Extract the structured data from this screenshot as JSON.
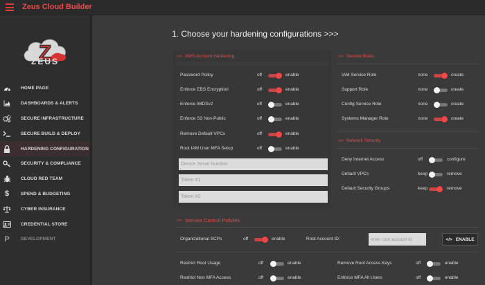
{
  "app": {
    "title": "Zeus Cloud Builder",
    "logo_text": "ZEUS",
    "logo_letter": "Z"
  },
  "colors": {
    "accent": "#e84a4a",
    "toggle_on": "#f04848",
    "bg": "#3a3a3a",
    "sidebar": "#2e2e2e"
  },
  "sidebar": {
    "items": [
      {
        "label": "HOME PAGE",
        "icon": "dashboard-gauge-icon"
      },
      {
        "label": "DASHBOARDS & ALERTS",
        "icon": "area-chart-icon"
      },
      {
        "label": "SECURE INFRASTRUCTURE",
        "icon": "cogs-icon"
      },
      {
        "label": "SECURE BUILD & DEPLOY",
        "icon": "terminal-icon"
      },
      {
        "label": "HARDENING CONFIGURATION",
        "icon": "lock-icon"
      },
      {
        "label": "SECURITY & COMPLIANCE",
        "icon": "key-icon"
      },
      {
        "label": "CLOUD RED TEAM",
        "icon": "bug-icon"
      },
      {
        "label": "SPEND & BUDGETING",
        "icon": "dollar-icon"
      },
      {
        "label": "CYBER INSURANCE",
        "icon": "balance-scale-icon"
      },
      {
        "label": "CREDENTIAL STORE",
        "icon": "id-card-icon"
      },
      {
        "label": "DEVELOPMENT",
        "icon": "product-hunt-icon"
      }
    ]
  },
  "main": {
    "title": "1. Choose your hardening configurations >>>"
  },
  "aws": {
    "title": "AWS Account Hardening",
    "rows": [
      {
        "label": "Password Policy",
        "off": "off",
        "on": "enable",
        "state": "on"
      },
      {
        "label": "Enforce EBS Encryption",
        "off": "off",
        "on": "enable",
        "state": "on"
      },
      {
        "label": "Enforce IMDSv2",
        "off": "off",
        "on": "enable",
        "state": "off"
      },
      {
        "label": "Enforce S3 Non-Public",
        "off": "off",
        "on": "enable",
        "state": "off"
      },
      {
        "label": "Remove Default VPCs",
        "off": "off",
        "on": "enable",
        "state": "on"
      },
      {
        "label": "Root IAM User MFA Setup",
        "off": "off",
        "on": "enable",
        "state": "off"
      }
    ],
    "inputs": [
      {
        "placeholder": "Device Serial Number"
      },
      {
        "placeholder": "Token #1"
      },
      {
        "placeholder": "Token #2"
      }
    ]
  },
  "service_roles": {
    "title": "Service Roles",
    "rows": [
      {
        "label": "IAM Service Role",
        "off": "none",
        "on": "create",
        "state": "on"
      },
      {
        "label": "Support Role",
        "off": "none",
        "on": "create",
        "state": "off"
      },
      {
        "label": "Config Service Role",
        "off": "none",
        "on": "create",
        "state": "off"
      },
      {
        "label": "Systems Manager Role",
        "off": "none",
        "on": "create",
        "state": "on"
      }
    ]
  },
  "network": {
    "title": "Network Security",
    "rows": [
      {
        "label": "Deny Internet Access",
        "off": "off",
        "on": "configure",
        "state": "off"
      },
      {
        "label": "Default VPCs",
        "off": "keep",
        "on": "remove",
        "state": "off"
      },
      {
        "label": "Default Security Groups",
        "off": "keep",
        "on": "remove",
        "state": "on"
      }
    ]
  },
  "scp": {
    "title": "Service Control Policies",
    "org": {
      "label": "Organizational SCPs",
      "off": "off",
      "on": "enable",
      "state": "on"
    },
    "root_account_label": "Root Account ID:",
    "root_account_placeholder": "enter root account id",
    "enable_button": "ENABLE",
    "enable_icon": "</>",
    "rows_left": [
      {
        "label": "Restrict Root Usage",
        "off": "off",
        "on": "enable",
        "state": "off"
      },
      {
        "label": "Restrict Non MFA Access",
        "off": "off",
        "on": "enable",
        "state": "off"
      }
    ],
    "rows_right": [
      {
        "label": "Remove Root Access Keys",
        "off": "off",
        "on": "enable",
        "state": "off"
      },
      {
        "label": "Enforce MFA All Users",
        "off": "off",
        "on": "enable",
        "state": "off"
      }
    ]
  },
  "section_icon": "</>"
}
